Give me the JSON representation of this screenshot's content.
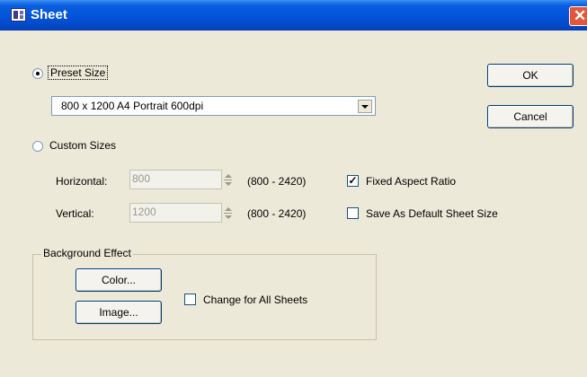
{
  "window": {
    "title": "Sheet",
    "close_glyph": "✕",
    "app_icon": "sheet-app-icon"
  },
  "preset": {
    "label": "Preset Size",
    "selected": true,
    "select_value": "800 x 1200 A4 Portrait 600dpi"
  },
  "custom": {
    "label": "Custom Sizes",
    "selected": false,
    "horizontal": {
      "label": "Horizontal:",
      "value": "800",
      "range": "(800 - 2420)"
    },
    "vertical": {
      "label": "Vertical:",
      "value": "1200",
      "range": "(800 - 2420)"
    }
  },
  "options": {
    "fixed_aspect": {
      "label": "Fixed Aspect Ratio",
      "checked": true
    },
    "save_default": {
      "label": "Save As Default Sheet Size",
      "checked": false
    }
  },
  "background": {
    "legend": "Background Effect",
    "color_label": "Color...",
    "image_label": "Image...",
    "change_all": {
      "label": "Change for All Sheets",
      "checked": false
    }
  },
  "buttons": {
    "ok_label": "OK",
    "cancel_label": "Cancel"
  },
  "colors": {
    "titlebar": "#0453d8",
    "close": "#e2573a",
    "dialog_bg": "#ece9d8"
  }
}
